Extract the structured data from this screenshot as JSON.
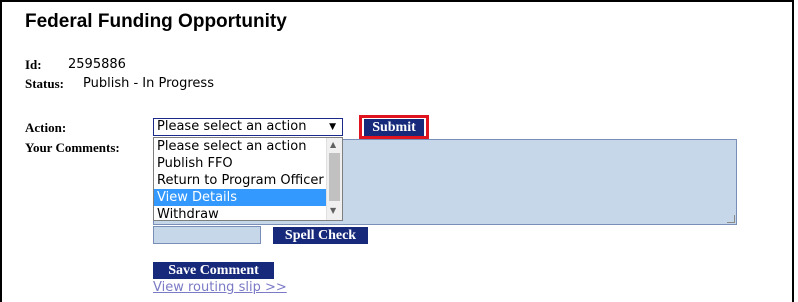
{
  "page": {
    "title": "Federal Funding Opportunity"
  },
  "record": {
    "id_label": "Id:",
    "id_value": "2595886",
    "status_label": "Status:",
    "status_value": "Publish - In Progress"
  },
  "form": {
    "action_label": "Action:",
    "select_value": "Please select an action",
    "submit_label": "Submit",
    "comments_label": "Your Comments:",
    "options": [
      "Please select an action",
      "Publish FFO",
      "Return to Program Officer",
      "View Details",
      "Withdraw"
    ],
    "highlighted_option": "View Details",
    "spell_check_label": "Spell Check",
    "save_comment_label": "Save Comment",
    "routing_link": "View routing slip >>"
  },
  "colors": {
    "button_bg": "#17297b",
    "highlight_border": "#e0141e",
    "field_bg": "#c7d7ea",
    "selected_option": "#3399ff"
  }
}
